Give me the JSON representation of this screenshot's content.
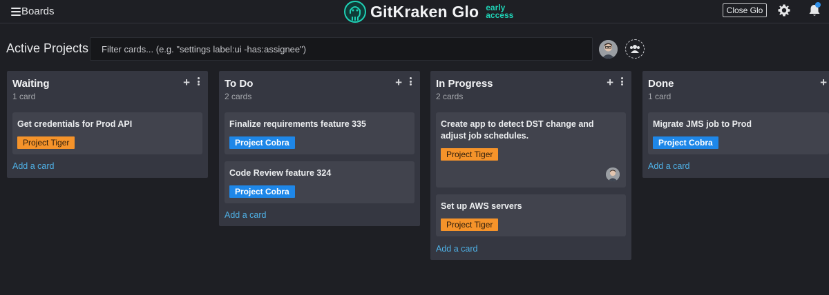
{
  "topbar": {
    "boards_label": "Boards",
    "brand_name": "GitKraken Glo",
    "brand_tag_line1": "early",
    "brand_tag_line2": "access",
    "close_label": "Close Glo"
  },
  "board": {
    "title": "Active Projects",
    "filter_placeholder": "Filter cards... (e.g. \"settings label:ui -has:assignee\")"
  },
  "colors": {
    "background": "#1e1f24",
    "column": "#353741",
    "card": "#41434d",
    "accent_link": "#4fb1e6",
    "label_tiger": "#f5932a",
    "label_cobra": "#1e87e8",
    "brand_teal": "#1fd1b5",
    "notification_dot": "#2f8fe8"
  },
  "columns": [
    {
      "title": "Waiting",
      "count": "1 card",
      "add_card": "Add a card",
      "cards": [
        {
          "name": "Get credentials for Prod API",
          "label": "Project Tiger"
        }
      ]
    },
    {
      "title": "To Do",
      "count": "2 cards",
      "add_card": "Add a card",
      "cards": [
        {
          "name": "Finalize requirements feature 335",
          "label": "Project Cobra"
        },
        {
          "name": "Code Review feature 324",
          "label": "Project Cobra"
        }
      ]
    },
    {
      "title": "In Progress",
      "count": "2 cards",
      "add_card": "Add a card",
      "cards": [
        {
          "name": "Create app to detect DST change and adjust job schedules.",
          "label": "Project Tiger",
          "has_assignee": true
        },
        {
          "name": "Set up AWS servers",
          "label": "Project Tiger"
        }
      ]
    },
    {
      "title": "Done",
      "count": "1 card",
      "add_card": "Add a card",
      "cards": [
        {
          "name": "Migrate JMS job to Prod",
          "label": "Project Cobra"
        }
      ]
    }
  ]
}
